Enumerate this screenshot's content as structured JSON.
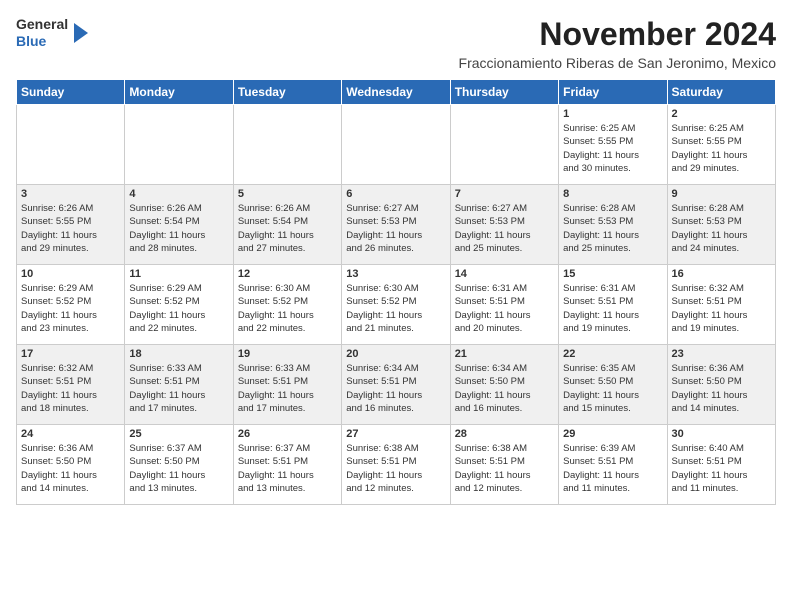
{
  "header": {
    "logo_line1": "General",
    "logo_line2": "Blue",
    "month_title": "November 2024",
    "subtitle": "Fraccionamiento Riberas de San Jeronimo, Mexico"
  },
  "weekdays": [
    "Sunday",
    "Monday",
    "Tuesday",
    "Wednesday",
    "Thursday",
    "Friday",
    "Saturday"
  ],
  "weeks": [
    [
      {
        "day": "",
        "info": ""
      },
      {
        "day": "",
        "info": ""
      },
      {
        "day": "",
        "info": ""
      },
      {
        "day": "",
        "info": ""
      },
      {
        "day": "",
        "info": ""
      },
      {
        "day": "1",
        "info": "Sunrise: 6:25 AM\nSunset: 5:55 PM\nDaylight: 11 hours\nand 30 minutes."
      },
      {
        "day": "2",
        "info": "Sunrise: 6:25 AM\nSunset: 5:55 PM\nDaylight: 11 hours\nand 29 minutes."
      }
    ],
    [
      {
        "day": "3",
        "info": "Sunrise: 6:26 AM\nSunset: 5:55 PM\nDaylight: 11 hours\nand 29 minutes."
      },
      {
        "day": "4",
        "info": "Sunrise: 6:26 AM\nSunset: 5:54 PM\nDaylight: 11 hours\nand 28 minutes."
      },
      {
        "day": "5",
        "info": "Sunrise: 6:26 AM\nSunset: 5:54 PM\nDaylight: 11 hours\nand 27 minutes."
      },
      {
        "day": "6",
        "info": "Sunrise: 6:27 AM\nSunset: 5:53 PM\nDaylight: 11 hours\nand 26 minutes."
      },
      {
        "day": "7",
        "info": "Sunrise: 6:27 AM\nSunset: 5:53 PM\nDaylight: 11 hours\nand 25 minutes."
      },
      {
        "day": "8",
        "info": "Sunrise: 6:28 AM\nSunset: 5:53 PM\nDaylight: 11 hours\nand 25 minutes."
      },
      {
        "day": "9",
        "info": "Sunrise: 6:28 AM\nSunset: 5:53 PM\nDaylight: 11 hours\nand 24 minutes."
      }
    ],
    [
      {
        "day": "10",
        "info": "Sunrise: 6:29 AM\nSunset: 5:52 PM\nDaylight: 11 hours\nand 23 minutes."
      },
      {
        "day": "11",
        "info": "Sunrise: 6:29 AM\nSunset: 5:52 PM\nDaylight: 11 hours\nand 22 minutes."
      },
      {
        "day": "12",
        "info": "Sunrise: 6:30 AM\nSunset: 5:52 PM\nDaylight: 11 hours\nand 22 minutes."
      },
      {
        "day": "13",
        "info": "Sunrise: 6:30 AM\nSunset: 5:52 PM\nDaylight: 11 hours\nand 21 minutes."
      },
      {
        "day": "14",
        "info": "Sunrise: 6:31 AM\nSunset: 5:51 PM\nDaylight: 11 hours\nand 20 minutes."
      },
      {
        "day": "15",
        "info": "Sunrise: 6:31 AM\nSunset: 5:51 PM\nDaylight: 11 hours\nand 19 minutes."
      },
      {
        "day": "16",
        "info": "Sunrise: 6:32 AM\nSunset: 5:51 PM\nDaylight: 11 hours\nand 19 minutes."
      }
    ],
    [
      {
        "day": "17",
        "info": "Sunrise: 6:32 AM\nSunset: 5:51 PM\nDaylight: 11 hours\nand 18 minutes."
      },
      {
        "day": "18",
        "info": "Sunrise: 6:33 AM\nSunset: 5:51 PM\nDaylight: 11 hours\nand 17 minutes."
      },
      {
        "day": "19",
        "info": "Sunrise: 6:33 AM\nSunset: 5:51 PM\nDaylight: 11 hours\nand 17 minutes."
      },
      {
        "day": "20",
        "info": "Sunrise: 6:34 AM\nSunset: 5:51 PM\nDaylight: 11 hours\nand 16 minutes."
      },
      {
        "day": "21",
        "info": "Sunrise: 6:34 AM\nSunset: 5:50 PM\nDaylight: 11 hours\nand 16 minutes."
      },
      {
        "day": "22",
        "info": "Sunrise: 6:35 AM\nSunset: 5:50 PM\nDaylight: 11 hours\nand 15 minutes."
      },
      {
        "day": "23",
        "info": "Sunrise: 6:36 AM\nSunset: 5:50 PM\nDaylight: 11 hours\nand 14 minutes."
      }
    ],
    [
      {
        "day": "24",
        "info": "Sunrise: 6:36 AM\nSunset: 5:50 PM\nDaylight: 11 hours\nand 14 minutes."
      },
      {
        "day": "25",
        "info": "Sunrise: 6:37 AM\nSunset: 5:50 PM\nDaylight: 11 hours\nand 13 minutes."
      },
      {
        "day": "26",
        "info": "Sunrise: 6:37 AM\nSunset: 5:51 PM\nDaylight: 11 hours\nand 13 minutes."
      },
      {
        "day": "27",
        "info": "Sunrise: 6:38 AM\nSunset: 5:51 PM\nDaylight: 11 hours\nand 12 minutes."
      },
      {
        "day": "28",
        "info": "Sunrise: 6:38 AM\nSunset: 5:51 PM\nDaylight: 11 hours\nand 12 minutes."
      },
      {
        "day": "29",
        "info": "Sunrise: 6:39 AM\nSunset: 5:51 PM\nDaylight: 11 hours\nand 11 minutes."
      },
      {
        "day": "30",
        "info": "Sunrise: 6:40 AM\nSunset: 5:51 PM\nDaylight: 11 hours\nand 11 minutes."
      }
    ]
  ]
}
